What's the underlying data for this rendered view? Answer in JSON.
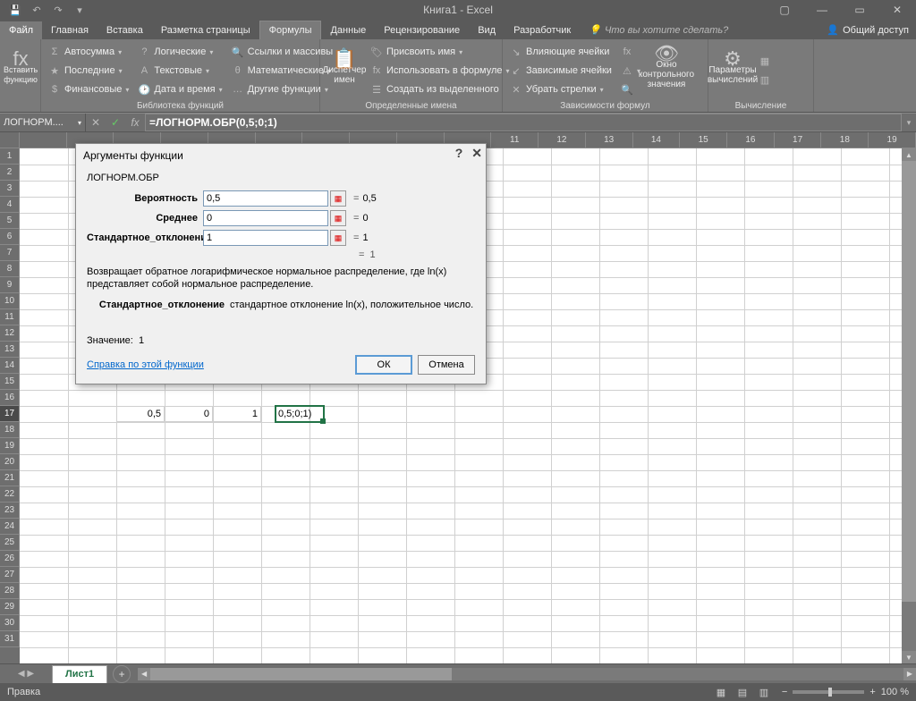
{
  "titlebar": {
    "title": "Книга1 - Excel"
  },
  "tabs": {
    "file": "Файл",
    "items": [
      "Главная",
      "Вставка",
      "Разметка страницы",
      "Формулы",
      "Данные",
      "Рецензирование",
      "Вид",
      "Разработчик"
    ],
    "active": "Формулы",
    "tell": "Что вы хотите сделать?",
    "share": "Общий доступ"
  },
  "ribbon": {
    "insert_fn": "Вставить функцию",
    "lib": {
      "autosum": "Автосумма",
      "recent": "Последние",
      "financial": "Финансовые",
      "logical": "Логические",
      "text": "Текстовые",
      "datetime": "Дата и время",
      "lookup": "Ссылки и массивы",
      "math": "Математические",
      "more": "Другие функции",
      "label": "Библиотека функций"
    },
    "names": {
      "mgr": "Диспетчер имен",
      "define": "Присвоить имя",
      "use": "Использовать в формуле",
      "create": "Создать из выделенного",
      "label": "Определенные имена"
    },
    "audit": {
      "prec": "Влияющие ячейки",
      "dep": "Зависимые ячейки",
      "remove": "Убрать стрелки",
      "watch": "Окно контрольного значения",
      "label": "Зависимости формул"
    },
    "calc": {
      "options": "Параметры вычислений",
      "label": "Вычисление"
    }
  },
  "fbar": {
    "name": "ЛОГНОРМ....",
    "formula": "=ЛОГНОРМ.ОБР(0,5;0;1)"
  },
  "grid": {
    "cols": [
      "11",
      "12",
      "13",
      "14",
      "15",
      "16",
      "17",
      "18",
      "19"
    ],
    "row_start": 1,
    "row_end": 31,
    "selected_row": 17,
    "cells": {
      "b17": "0,5",
      "c17": "0",
      "d17": "1",
      "e17": "0,5;0;1)"
    }
  },
  "sheet": {
    "name": "Лист1"
  },
  "status": {
    "mode": "Правка",
    "zoom": "100 %"
  },
  "dialog": {
    "title": "Аргументы функции",
    "func": "ЛОГНОРМ.ОБР",
    "args": [
      {
        "label": "Вероятность",
        "value": "0,5",
        "result": "0,5"
      },
      {
        "label": "Среднее",
        "value": "0",
        "result": "0"
      },
      {
        "label": "Стандартное_отклонение",
        "value": "1",
        "result": "1"
      }
    ],
    "overall_eq": "1",
    "desc": "Возвращает обратное логарифмическое нормальное распределение, где ln(x) представляет собой нормальное распределение.",
    "arg_name": "Стандартное_отклонение",
    "arg_desc": "стандартное отклонение ln(x), положительное число.",
    "value_label": "Значение:",
    "value": "1",
    "help": "Справка по этой функции",
    "ok": "ОК",
    "cancel": "Отмена"
  }
}
